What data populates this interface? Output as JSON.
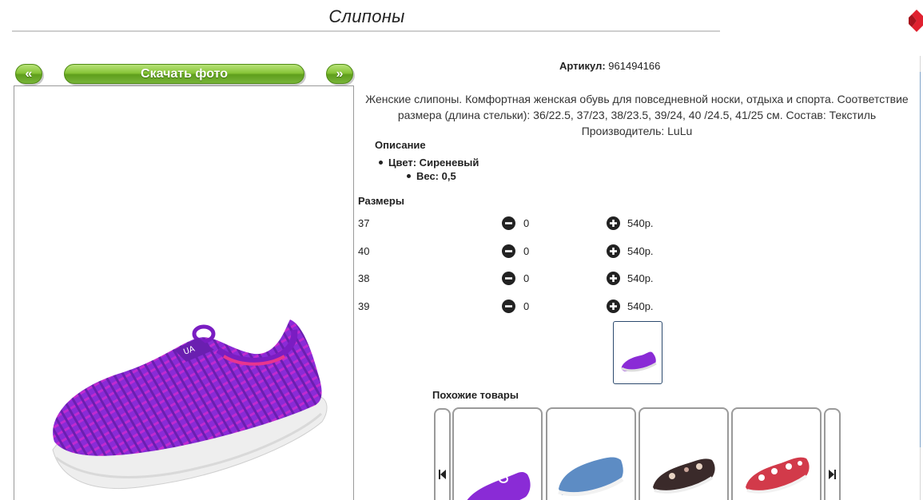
{
  "page": {
    "title": "Слипоны"
  },
  "gallery": {
    "prev_label": "«",
    "download_label": "Скачать фото",
    "next_label": "»"
  },
  "product": {
    "article_label": "Артикул:",
    "article_value": "961494166",
    "description": "Женские слипоны. Комфортная женская обувь для повседневной носки, отдыха и спорта. Соответствие размера (длина стельки): 36/22.5, 37/23, 38/23.5, 39/24, 40 /24.5, 41/25 см. Состав: Текстиль Производитель: LuLu",
    "desc_title": "Описание",
    "properties": {
      "color": "Цвет: Сиреневый",
      "weight": "Вес: 0,5"
    },
    "shoe_color": "#8a2bd6"
  },
  "sizes": {
    "title": "Размеры",
    "rows": [
      {
        "size": "37",
        "qty": "0",
        "price": "540р."
      },
      {
        "size": "40",
        "qty": "0",
        "price": "540р."
      },
      {
        "size": "38",
        "qty": "0",
        "price": "540р."
      },
      {
        "size": "39",
        "qty": "0",
        "price": "540р."
      }
    ]
  },
  "similar": {
    "title": "Похожие товары",
    "items": [
      {
        "name": "purple-slipon",
        "color": "#8a2bd6"
      },
      {
        "name": "denim-slipon",
        "color": "#5d8cc4"
      },
      {
        "name": "floral-dark-slipon",
        "color": "#3a2a2a"
      },
      {
        "name": "red-pattern-slipon",
        "color": "#d23a4a"
      }
    ]
  },
  "colors": {
    "button_green": "#6fae2a",
    "thumb_border": "#2c4a6e",
    "corner_red": "#e0212f"
  }
}
